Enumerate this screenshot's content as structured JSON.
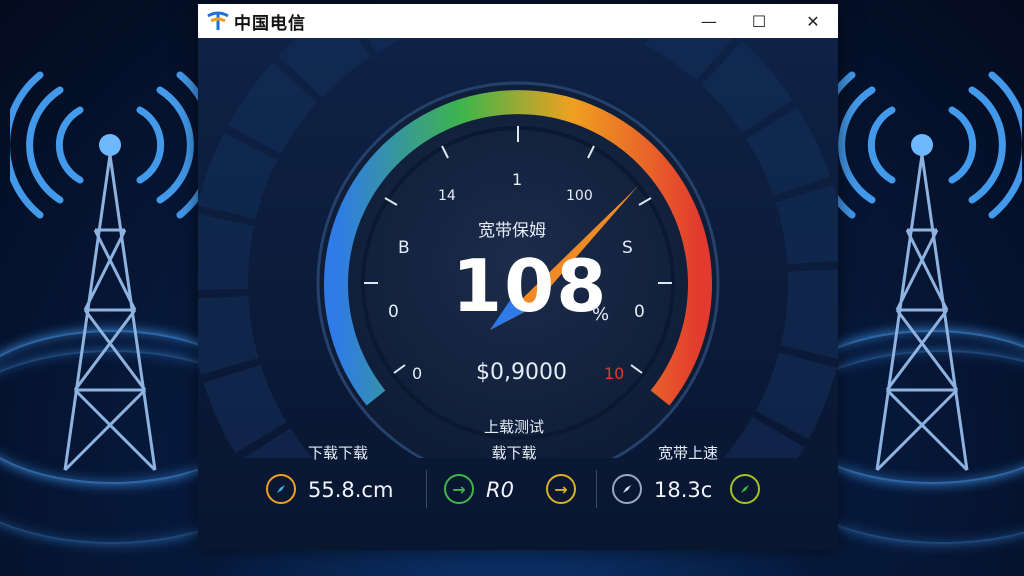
{
  "window": {
    "app_title": "中国电信",
    "controls": {
      "minimize": "—",
      "maximize": "☐",
      "close": "✕"
    }
  },
  "gauge": {
    "caption": "宽带保姆",
    "value": "108",
    "unit": "%",
    "sub_value": "$0,9000",
    "footer_label": "上载测试",
    "ticks": {
      "top_left": "14",
      "top": "1",
      "top_right": "100",
      "mid_left": "B",
      "mid_right": "S",
      "left": "0",
      "right": "0",
      "bottom_left": "0",
      "bottom_right": "10"
    },
    "colors": {
      "arc_start": "#2f7be8",
      "arc_mid": "#3fb54a",
      "arc_end": "#e23a2e",
      "needle": "#f08a24"
    }
  },
  "stats": {
    "download": {
      "title": "下载下载",
      "value": "55.8.cm",
      "icon": "compass-icon"
    },
    "middle": {
      "title": "载下载",
      "value": "R0",
      "icon": "arrow-right-icon"
    },
    "upload": {
      "title": "宽带上速",
      "value": "18.3c",
      "icon": "compass-icon"
    }
  }
}
